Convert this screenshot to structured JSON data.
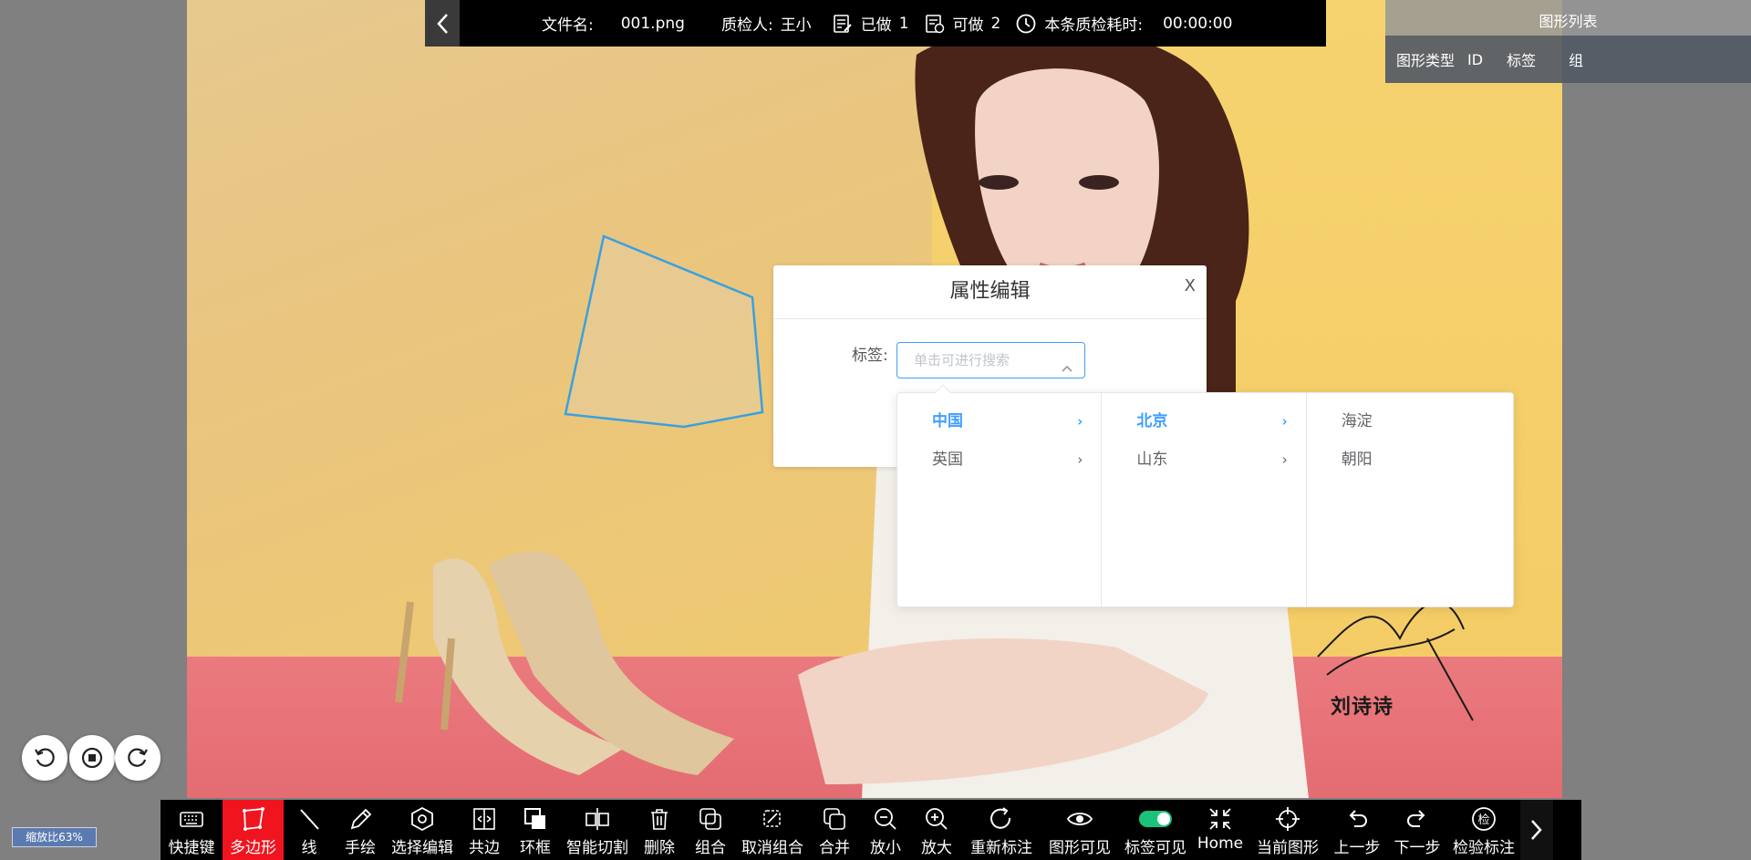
{
  "topbar": {
    "file_label": "文件名:",
    "file_value": "001.png",
    "inspector_label": "质检人:",
    "inspector_value": "王小",
    "done_label": "已做",
    "done_value": "1",
    "todo_label": "可做",
    "todo_value": "2",
    "time_label": "本条质检耗时:",
    "time_value": "00:00:00"
  },
  "shape_panel": {
    "title": "图形列表",
    "columns": [
      "图形类型",
      "ID",
      "标签",
      "组"
    ]
  },
  "dialog": {
    "title": "属性编辑",
    "close": "X",
    "tag_label": "标签:",
    "tag_placeholder": "单击可进行搜索"
  },
  "cascader": {
    "col1": [
      "中国",
      "英国"
    ],
    "col2": [
      "北京",
      "山东"
    ],
    "col3": [
      "海淀",
      "朝阳"
    ]
  },
  "photo": {
    "signature": "刘诗诗"
  },
  "zoom": {
    "label": "缩放比63%"
  },
  "toolbar": {
    "items": [
      "快捷键",
      "多边形",
      "线",
      "手绘",
      "选择编辑",
      "共边",
      "环框",
      "智能切割",
      "删除",
      "组合",
      "取消组合",
      "合并",
      "放小",
      "放大",
      "重新标注",
      "图形可见",
      "标签可见",
      "Home",
      "当前图形",
      "上一步",
      "下一步",
      "检验标注"
    ],
    "active": "多边形"
  },
  "colors": {
    "accent": "#409eff",
    "active_tool": "#f0141e",
    "polygon_stroke": "#3aa0e0",
    "toggle_on": "#1bc37a"
  }
}
